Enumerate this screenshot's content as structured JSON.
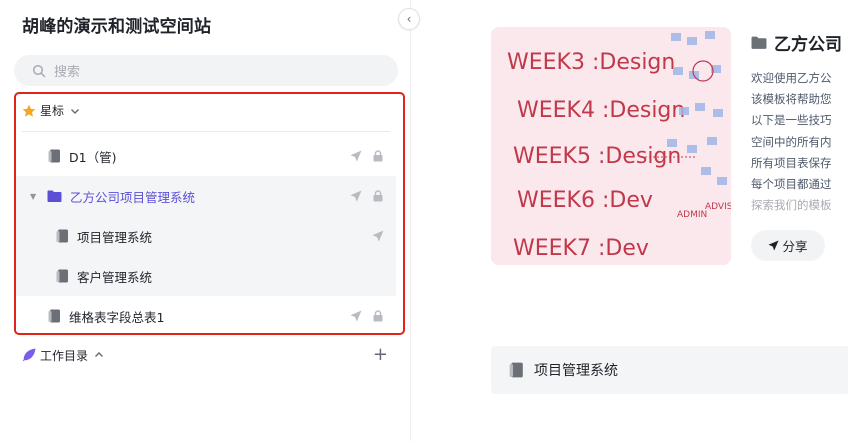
{
  "sidebar": {
    "space_title": "胡峰的演示和测试空间站",
    "search_placeholder": "搜索",
    "starred": {
      "header_label": "星标",
      "items": [
        {
          "label": "D1（管)",
          "type": "doc"
        },
        {
          "label": "乙方公司项目管理系统",
          "type": "folder"
        },
        {
          "label": "项目管理系统",
          "type": "doc"
        },
        {
          "label": "客户管理系统",
          "type": "doc"
        },
        {
          "label": "维格表字段总表1",
          "type": "doc"
        }
      ]
    },
    "workdir_label": "工作目录",
    "add_symbol": "+",
    "collapse_symbol": "‹"
  },
  "main": {
    "folder_title": "乙方公司",
    "description_lines": [
      "欢迎使用乙方公",
      "该模板将帮助您",
      "以下是一些技巧",
      "空间中的所有内",
      "所有项目表保存",
      "每个项目都通过",
      "探索我们的模板"
    ],
    "share_label": "分享",
    "project_card_label": "项目管理系统",
    "whiteboard_text": [
      "WEEK3 :Design",
      "WEEK4 :Design",
      "WEEK5 :Design",
      "WEEK6 :Dev",
      "WEEK7 :Dev",
      "ADMIN",
      "ADVISE"
    ]
  },
  "colors": {
    "accent_purple": "#5b4fd6",
    "highlight_border": "#e2231a",
    "star": "#f5a623"
  },
  "icons": {
    "search": "search-icon",
    "star": "star-icon",
    "doc": "doc-icon",
    "folder": "folder-icon",
    "send": "send-icon",
    "lock": "lock-icon",
    "feather": "feather-icon"
  }
}
